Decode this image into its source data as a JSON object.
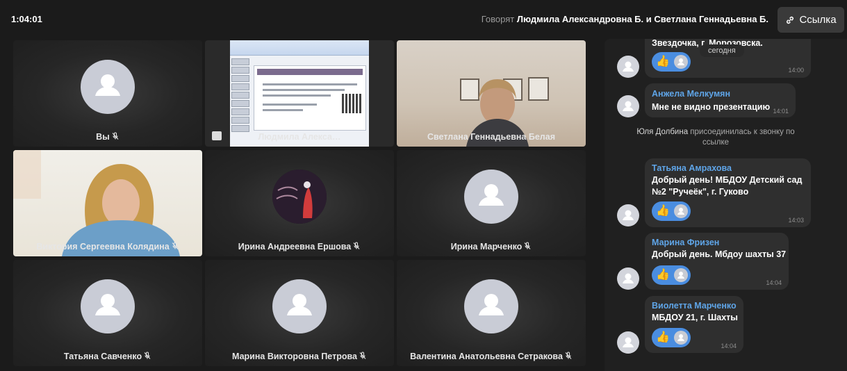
{
  "header": {
    "timer": "1:04:01",
    "speaking_prefix": "Говорят",
    "speaking_names": "Людмила Александровна Б. и Светлана Геннадьевна Б.",
    "link_button": "Ссылка"
  },
  "tiles": [
    {
      "name": "Вы",
      "muted": true
    },
    {
      "name": "Людмила Алекса…",
      "muted": false
    },
    {
      "name": "Светлана Геннадьевна Белая",
      "muted": false
    },
    {
      "name": "Виктория Сергеевна Колядина",
      "muted": true
    },
    {
      "name": "Ирина Андреевна Ершова",
      "muted": true
    },
    {
      "name": "Ирина Марченко",
      "muted": true
    },
    {
      "name": "Татьяна Савченко",
      "muted": true
    },
    {
      "name": "Марина Викторовна Петрова",
      "muted": true
    },
    {
      "name": "Валентина Анатольевна Сетракова",
      "muted": true
    }
  ],
  "chat": {
    "date_chip": "сегодня",
    "messages": [
      {
        "author": "",
        "text": "Звездочка, г. Морозовска.",
        "time": "14:00",
        "reaction": true
      },
      {
        "author": "Анжела Мелкумян",
        "text": "Мне не видно презентацию",
        "time": "14:01",
        "reaction": false
      },
      {
        "author": "Татьяна Амрахова",
        "text": "Добрый день! МБДОУ Детский сад №2 \"Ручеёк\", г. Гуково",
        "time": "14:03",
        "reaction": true
      },
      {
        "author": "Марина Фризен",
        "text": "Добрый день. Мбдоу шахты 37",
        "time": "14:04",
        "reaction": true
      },
      {
        "author": "Виолетта Марченко",
        "text": "МБДОУ 21, г. Шахты",
        "time": "14:04",
        "reaction": true
      }
    ],
    "system": {
      "name": "Юля Долбина",
      "text": "присоединилась к звонку по ссылке"
    }
  },
  "colors": {
    "background": "#1b1b1b",
    "accent": "#4a8de0",
    "author": "#5fa5e8",
    "bubble": "#2f2f2f"
  }
}
